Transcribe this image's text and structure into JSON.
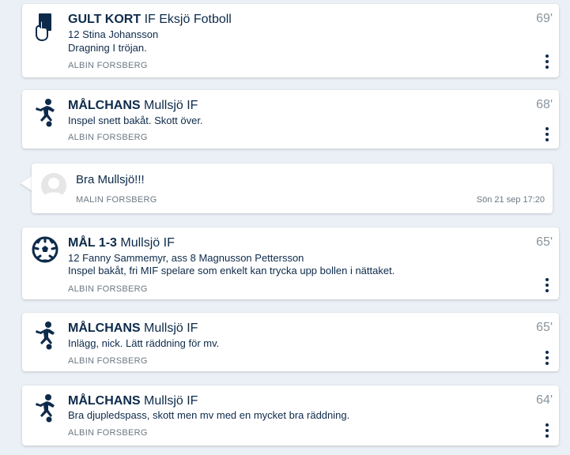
{
  "feed": {
    "events": [
      {
        "type": "GULT KORT",
        "team": "IF Eksjö Fotboll",
        "lines": [
          "12 Stina Johansson",
          "Dragning I tröjan."
        ],
        "author": "ALBIN FORSBERG",
        "minute": "69'",
        "icon": "yellow-card-icon"
      },
      {
        "type": "MÅLCHANS",
        "team": "Mullsjö IF",
        "lines": [
          "Inspel snett bakåt. Skott över."
        ],
        "author": "ALBIN FORSBERG",
        "minute": "68'",
        "icon": "player-kick-icon"
      },
      {
        "type": "MÅL 1-3",
        "team": "Mullsjö IF",
        "lines": [
          "12 Fanny Sammemyr, ass 8 Magnusson Pettersson",
          "Inspel bakåt, fri MIF spelare som enkelt kan trycka upp bollen i nättaket."
        ],
        "author": "ALBIN FORSBERG",
        "minute": "65'",
        "icon": "football-icon"
      },
      {
        "type": "MÅLCHANS",
        "team": "Mullsjö IF",
        "lines": [
          "Inlägg, nick. Lätt räddning för mv."
        ],
        "author": "ALBIN FORSBERG",
        "minute": "65'",
        "icon": "player-kick-icon"
      },
      {
        "type": "MÅLCHANS",
        "team": "Mullsjö IF",
        "lines": [
          "Bra djupledspass, skott men mv med en mycket bra räddning."
        ],
        "author": "ALBIN FORSBERG",
        "minute": "64'",
        "icon": "player-kick-icon"
      }
    ],
    "comment": {
      "text": "Bra Mullsjö!!!",
      "author": "MALIN FORSBERG",
      "time": "Sön 21 sep 17:20"
    }
  },
  "colors": {
    "background": "#eaf0f5",
    "text": "#0d2a4a",
    "muted": "#6b7884",
    "minute": "#8a949d"
  }
}
